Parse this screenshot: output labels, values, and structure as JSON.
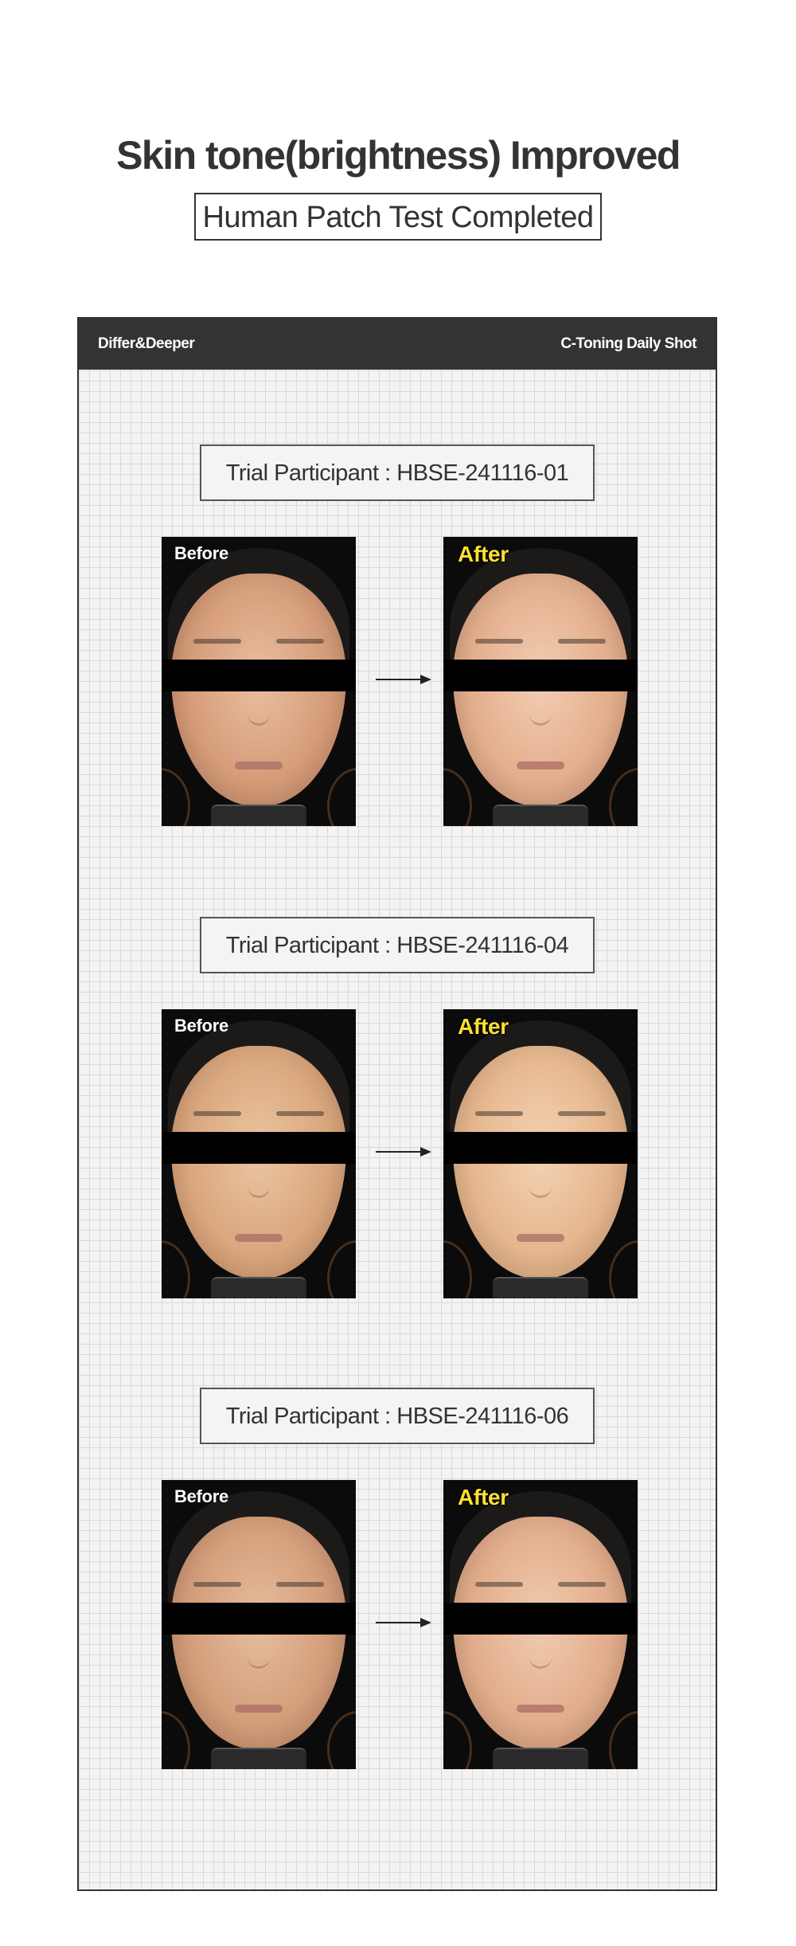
{
  "header": {
    "title": "Skin tone(brightness) Improved",
    "subtitle": "Human Patch Test Completed"
  },
  "panel": {
    "brand": "Differ&Deeper",
    "product": "C-Toning Daily Shot"
  },
  "labels": {
    "before": "Before",
    "after": "After"
  },
  "trials": [
    {
      "label": "Trial Participant : HBSE-241116-01"
    },
    {
      "label": "Trial Participant : HBSE-241116-04"
    },
    {
      "label": "Trial Participant : HBSE-241116-06"
    }
  ],
  "icons": {
    "arrow": "arrow-right-icon"
  },
  "colors": {
    "dark": "#333333",
    "after_label": "#ffe030",
    "grid_bg": "#f3f3f3"
  }
}
